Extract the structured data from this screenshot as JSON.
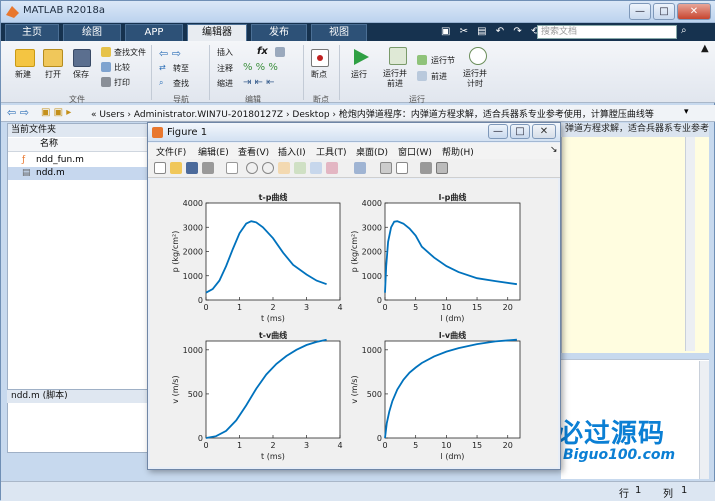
{
  "window": {
    "title": "MATLAB R2018a",
    "min": "—",
    "max": "□",
    "close": "✕"
  },
  "tabs": [
    {
      "label": "主页"
    },
    {
      "label": "绘图"
    },
    {
      "label": "APP"
    },
    {
      "label": "编辑器"
    },
    {
      "label": "发布"
    },
    {
      "label": "视图"
    }
  ],
  "search_placeholder": "搜索文档",
  "ribbon": {
    "file": {
      "new": "新建",
      "open": "打开",
      "save": "保存",
      "find_files": "查找文件",
      "compare": "比较",
      "print": "打印",
      "group": "文件"
    },
    "nav": {
      "goto": "转至",
      "find": "查找",
      "group": "导航"
    },
    "edit": {
      "insert": "插入",
      "comment": "注释",
      "indent": "缩进",
      "fx": "fx",
      "group": "编辑"
    },
    "breakpoints": {
      "label": "断点",
      "group": "断点"
    },
    "run": {
      "run": "运行",
      "run_advance": "运行并\n前进",
      "run_section": "运行节",
      "advance": "前进",
      "run_time": "运行并\n计时",
      "group": "运行"
    }
  },
  "address": {
    "path": "« Users › Administrator.WIN7U-20180127Z › Desktop › 枪炮内弹道程序：内弹道方程求解，适合兵器系专业参考使用，计算膛压曲线等"
  },
  "current_folder": {
    "title": "当前文件夹",
    "column": "名称",
    "files": [
      {
        "name": "ndd_fun.m"
      },
      {
        "name": "ndd.m"
      }
    ]
  },
  "details": "ndd.m  (脚本)",
  "editor_tab": "弹道方程求解，适合兵器系专业参考使",
  "figure": {
    "title": "Figure 1",
    "menus": [
      "文件(F)",
      "编辑(E)",
      "查看(V)",
      "插入(I)",
      "工具(T)",
      "桌面(D)",
      "窗口(W)",
      "帮助(H)"
    ]
  },
  "status": {
    "row_label": "行",
    "row": "1",
    "col_label": "列",
    "col": "1"
  },
  "watermark": {
    "cn": "必过源码",
    "en": "Biguo100.com"
  },
  "colors": {
    "line": "#0072bd",
    "tab_bg": "#16324f",
    "active_tab": "#e8ecf1"
  },
  "chart_data": [
    {
      "type": "line",
      "title": "t-p曲线",
      "xlabel": "t (ms)",
      "ylabel": "p (kg/cm²)",
      "xlim": [
        0,
        4
      ],
      "ylim": [
        0,
        4000
      ],
      "xticks": [
        0,
        1,
        2,
        3,
        4
      ],
      "yticks": [
        0,
        1000,
        2000,
        3000,
        4000
      ],
      "x": [
        0,
        0.2,
        0.4,
        0.6,
        0.8,
        1.0,
        1.2,
        1.35,
        1.5,
        1.7,
        2.0,
        2.3,
        2.6,
        3.0,
        3.3,
        3.6
      ],
      "y": [
        300,
        450,
        800,
        1400,
        2100,
        2750,
        3150,
        3250,
        3200,
        3000,
        2550,
        1950,
        1450,
        1050,
        800,
        650
      ]
    },
    {
      "type": "line",
      "title": "l-p曲线",
      "xlabel": "l (dm)",
      "ylabel": "p (kg/cm²)",
      "xlim": [
        0,
        22
      ],
      "ylim": [
        0,
        4000
      ],
      "xticks": [
        0,
        5,
        10,
        15,
        20
      ],
      "yticks": [
        0,
        1000,
        2000,
        3000,
        4000
      ],
      "x": [
        0,
        0.2,
        0.5,
        1,
        1.5,
        2,
        3,
        4,
        5,
        6,
        8,
        10,
        12,
        15,
        18,
        21.5
      ],
      "y": [
        300,
        1400,
        2400,
        3000,
        3230,
        3250,
        3150,
        2950,
        2650,
        2200,
        1750,
        1400,
        1150,
        900,
        780,
        650
      ]
    },
    {
      "type": "line",
      "title": "t-v曲线",
      "xlabel": "t (ms)",
      "ylabel": "v (m/s)",
      "xlim": [
        0,
        4
      ],
      "ylim": [
        0,
        1100
      ],
      "xticks": [
        0,
        1,
        2,
        3,
        4
      ],
      "yticks": [
        0,
        500,
        1000
      ],
      "x": [
        0,
        0.3,
        0.6,
        0.9,
        1.2,
        1.5,
        1.8,
        2.1,
        2.4,
        2.7,
        3.0,
        3.3,
        3.6
      ],
      "y": [
        0,
        20,
        80,
        200,
        370,
        560,
        720,
        840,
        930,
        1000,
        1055,
        1090,
        1115
      ]
    },
    {
      "type": "line",
      "title": "l-v曲线",
      "xlabel": "l (dm)",
      "ylabel": "v (m/s)",
      "xlim": [
        0,
        22
      ],
      "ylim": [
        0,
        1100
      ],
      "xticks": [
        0,
        5,
        10,
        15,
        20
      ],
      "yticks": [
        0,
        500,
        1000
      ],
      "x": [
        0,
        0.3,
        0.7,
        1.2,
        2,
        3,
        4,
        5,
        6,
        8,
        10,
        12,
        15,
        18,
        21.5
      ],
      "y": [
        0,
        170,
        300,
        420,
        550,
        660,
        740,
        800,
        850,
        925,
        980,
        1020,
        1065,
        1095,
        1115
      ]
    }
  ]
}
